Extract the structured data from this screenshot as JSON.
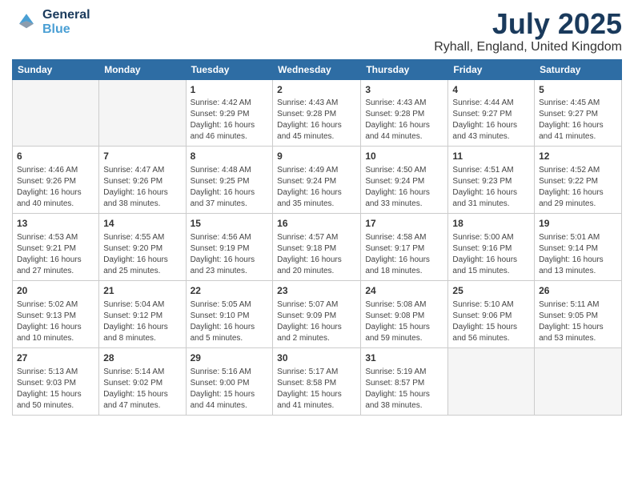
{
  "header": {
    "logo_general": "General",
    "logo_blue": "Blue",
    "title": "July 2025",
    "subtitle": "Ryhall, England, United Kingdom"
  },
  "weekdays": [
    "Sunday",
    "Monday",
    "Tuesday",
    "Wednesday",
    "Thursday",
    "Friday",
    "Saturday"
  ],
  "weeks": [
    [
      {
        "day": "",
        "empty": true
      },
      {
        "day": "",
        "empty": true
      },
      {
        "day": "1",
        "sunrise": "4:42 AM",
        "sunset": "9:29 PM",
        "daylight": "16 hours and 46 minutes."
      },
      {
        "day": "2",
        "sunrise": "4:43 AM",
        "sunset": "9:28 PM",
        "daylight": "16 hours and 45 minutes."
      },
      {
        "day": "3",
        "sunrise": "4:43 AM",
        "sunset": "9:28 PM",
        "daylight": "16 hours and 44 minutes."
      },
      {
        "day": "4",
        "sunrise": "4:44 AM",
        "sunset": "9:27 PM",
        "daylight": "16 hours and 43 minutes."
      },
      {
        "day": "5",
        "sunrise": "4:45 AM",
        "sunset": "9:27 PM",
        "daylight": "16 hours and 41 minutes."
      }
    ],
    [
      {
        "day": "6",
        "sunrise": "4:46 AM",
        "sunset": "9:26 PM",
        "daylight": "16 hours and 40 minutes."
      },
      {
        "day": "7",
        "sunrise": "4:47 AM",
        "sunset": "9:26 PM",
        "daylight": "16 hours and 38 minutes."
      },
      {
        "day": "8",
        "sunrise": "4:48 AM",
        "sunset": "9:25 PM",
        "daylight": "16 hours and 37 minutes."
      },
      {
        "day": "9",
        "sunrise": "4:49 AM",
        "sunset": "9:24 PM",
        "daylight": "16 hours and 35 minutes."
      },
      {
        "day": "10",
        "sunrise": "4:50 AM",
        "sunset": "9:24 PM",
        "daylight": "16 hours and 33 minutes."
      },
      {
        "day": "11",
        "sunrise": "4:51 AM",
        "sunset": "9:23 PM",
        "daylight": "16 hours and 31 minutes."
      },
      {
        "day": "12",
        "sunrise": "4:52 AM",
        "sunset": "9:22 PM",
        "daylight": "16 hours and 29 minutes."
      }
    ],
    [
      {
        "day": "13",
        "sunrise": "4:53 AM",
        "sunset": "9:21 PM",
        "daylight": "16 hours and 27 minutes."
      },
      {
        "day": "14",
        "sunrise": "4:55 AM",
        "sunset": "9:20 PM",
        "daylight": "16 hours and 25 minutes."
      },
      {
        "day": "15",
        "sunrise": "4:56 AM",
        "sunset": "9:19 PM",
        "daylight": "16 hours and 23 minutes."
      },
      {
        "day": "16",
        "sunrise": "4:57 AM",
        "sunset": "9:18 PM",
        "daylight": "16 hours and 20 minutes."
      },
      {
        "day": "17",
        "sunrise": "4:58 AM",
        "sunset": "9:17 PM",
        "daylight": "16 hours and 18 minutes."
      },
      {
        "day": "18",
        "sunrise": "5:00 AM",
        "sunset": "9:16 PM",
        "daylight": "16 hours and 15 minutes."
      },
      {
        "day": "19",
        "sunrise": "5:01 AM",
        "sunset": "9:14 PM",
        "daylight": "16 hours and 13 minutes."
      }
    ],
    [
      {
        "day": "20",
        "sunrise": "5:02 AM",
        "sunset": "9:13 PM",
        "daylight": "16 hours and 10 minutes."
      },
      {
        "day": "21",
        "sunrise": "5:04 AM",
        "sunset": "9:12 PM",
        "daylight": "16 hours and 8 minutes."
      },
      {
        "day": "22",
        "sunrise": "5:05 AM",
        "sunset": "9:10 PM",
        "daylight": "16 hours and 5 minutes."
      },
      {
        "day": "23",
        "sunrise": "5:07 AM",
        "sunset": "9:09 PM",
        "daylight": "16 hours and 2 minutes."
      },
      {
        "day": "24",
        "sunrise": "5:08 AM",
        "sunset": "9:08 PM",
        "daylight": "15 hours and 59 minutes."
      },
      {
        "day": "25",
        "sunrise": "5:10 AM",
        "sunset": "9:06 PM",
        "daylight": "15 hours and 56 minutes."
      },
      {
        "day": "26",
        "sunrise": "5:11 AM",
        "sunset": "9:05 PM",
        "daylight": "15 hours and 53 minutes."
      }
    ],
    [
      {
        "day": "27",
        "sunrise": "5:13 AM",
        "sunset": "9:03 PM",
        "daylight": "15 hours and 50 minutes."
      },
      {
        "day": "28",
        "sunrise": "5:14 AM",
        "sunset": "9:02 PM",
        "daylight": "15 hours and 47 minutes."
      },
      {
        "day": "29",
        "sunrise": "5:16 AM",
        "sunset": "9:00 PM",
        "daylight": "15 hours and 44 minutes."
      },
      {
        "day": "30",
        "sunrise": "5:17 AM",
        "sunset": "8:58 PM",
        "daylight": "15 hours and 41 minutes."
      },
      {
        "day": "31",
        "sunrise": "5:19 AM",
        "sunset": "8:57 PM",
        "daylight": "15 hours and 38 minutes."
      },
      {
        "day": "",
        "empty": true
      },
      {
        "day": "",
        "empty": true
      }
    ]
  ]
}
